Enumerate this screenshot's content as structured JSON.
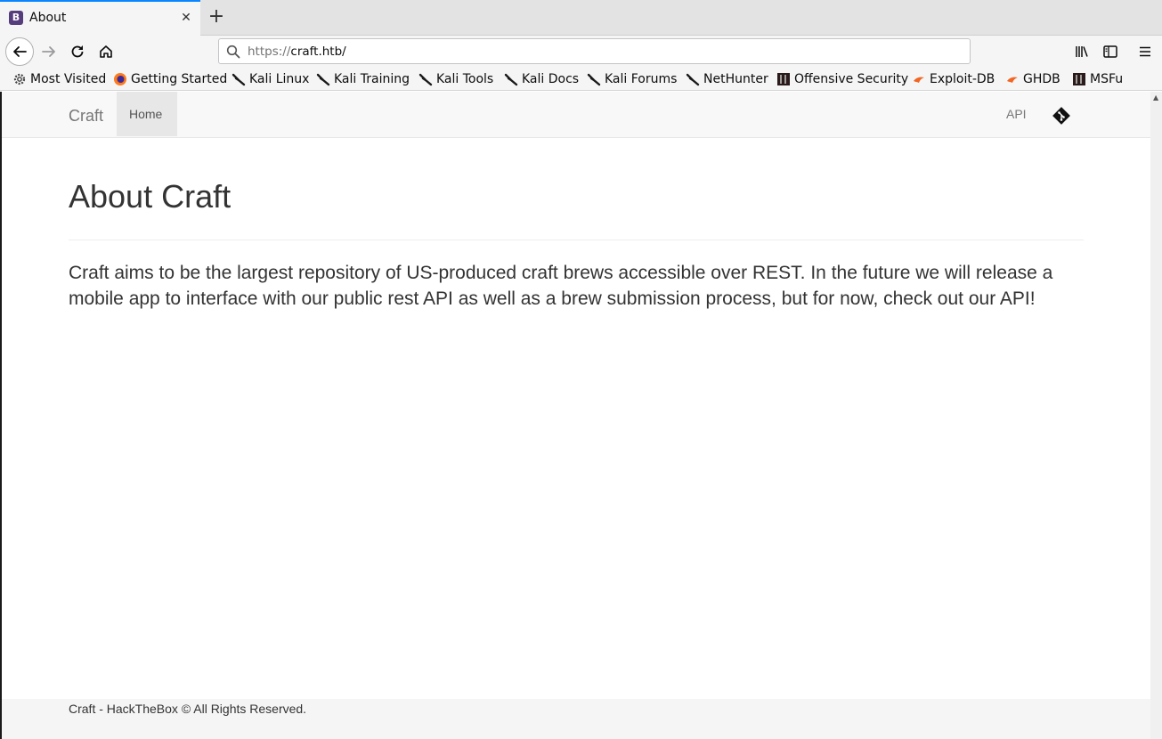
{
  "browser": {
    "tab": {
      "title": "About",
      "favicon_letter": "B",
      "favicon_color": "#563d7c"
    },
    "url": {
      "scheme": "https://",
      "host": "craft.htb/"
    },
    "accent": "#0a84ff",
    "bookmarks": [
      {
        "label": "Most Visited",
        "icon": "gear-icon"
      },
      {
        "label": "Getting Started",
        "icon": "firefox-icon"
      },
      {
        "label": "Kali Linux",
        "icon": "kali-dragon-icon"
      },
      {
        "label": "Kali Training",
        "icon": "kali-dragon-icon"
      },
      {
        "label": "Kali Tools",
        "icon": "kali-dragon-icon"
      },
      {
        "label": "Kali Docs",
        "icon": "kali-dragon-icon"
      },
      {
        "label": "Kali Forums",
        "icon": "kali-dragon-icon"
      },
      {
        "label": "NetHunter",
        "icon": "kali-dragon-icon"
      },
      {
        "label": "Offensive Security",
        "icon": "offsec-icon"
      },
      {
        "label": "Exploit-DB",
        "icon": "exploitdb-icon"
      },
      {
        "label": "GHDB",
        "icon": "exploitdb-icon"
      },
      {
        "label": "MSFu",
        "icon": "offsec-icon"
      }
    ]
  },
  "site": {
    "brand": "Craft",
    "nav": {
      "home": "Home",
      "api": "API",
      "git_icon": "git-icon"
    },
    "heading": "About Craft",
    "lead": "Craft aims to be the largest repository of US-produced craft brews accessible over REST. In the future we will release a mobile app to interface with our public rest API as well as a brew submission process, but for now, check out our API!",
    "footer": "Craft - HackTheBox © All Rights Reserved."
  }
}
